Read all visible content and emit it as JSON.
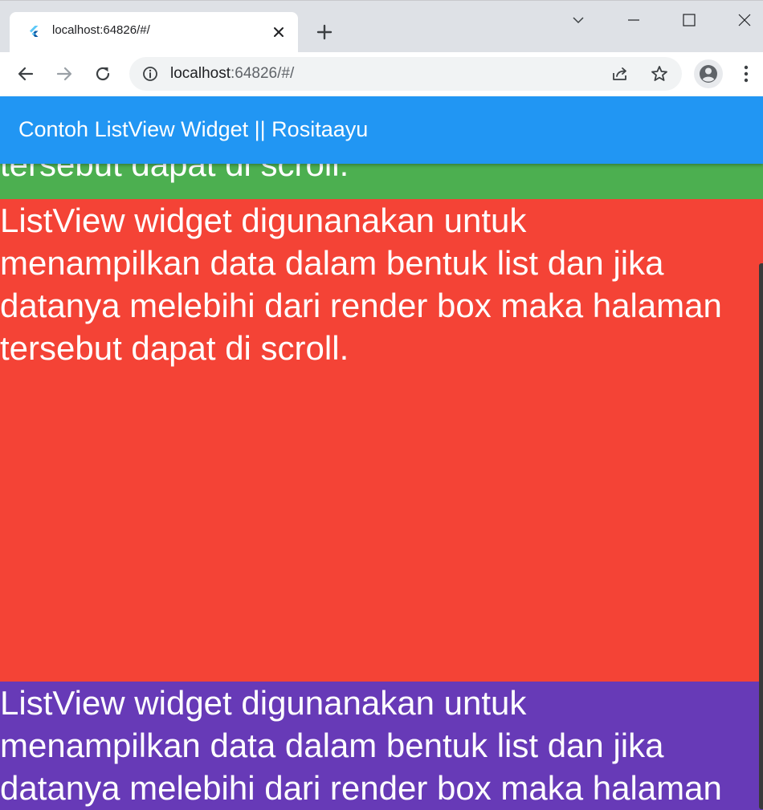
{
  "browser": {
    "tab": {
      "title": "localhost:64826/#/"
    },
    "address": {
      "host": "localhost",
      "rest": ":64826/#/"
    }
  },
  "app": {
    "title": "Contoh ListView Widget || Rositaayu",
    "colors": {
      "appbar": "#2196f3",
      "item_green": "#4caf50",
      "item_red": "#f44336",
      "item_purple": "#673ab7"
    },
    "list": {
      "items": [
        {
          "color": "green",
          "text": "ListView widget digunanakan untuk\nmenampilkan data dalam bentuk list dan jika\ndatanya melebihi dari render box maka halaman\ntersebut dapat di scroll."
        },
        {
          "color": "red",
          "text": "ListView widget digunanakan untuk\nmenampilkan data dalam bentuk list dan jika\ndatanya melebihi dari render box maka halaman\ntersebut dapat di scroll."
        },
        {
          "color": "purple",
          "text": "ListView widget digunanakan untuk\nmenampilkan data dalam bentuk list dan jika\ndatanya melebihi dari render box maka halaman"
        }
      ]
    }
  }
}
